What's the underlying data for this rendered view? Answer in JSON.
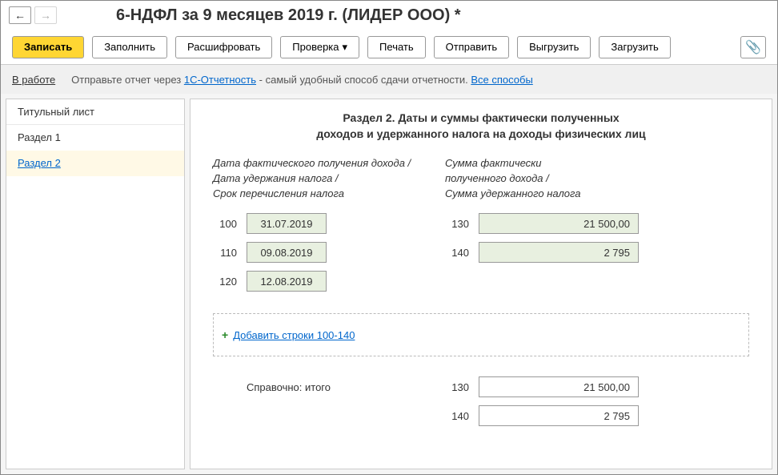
{
  "title": "6-НДФЛ за 9 месяцев 2019 г. (ЛИДЕР ООО) *",
  "toolbar": {
    "write": "Записать",
    "fill": "Заполнить",
    "decode": "Расшифровать",
    "check": "Проверка",
    "print": "Печать",
    "send": "Отправить",
    "export": "Выгрузить",
    "import": "Загрузить"
  },
  "status": {
    "label": "В работе",
    "text1": "Отправьте отчет через ",
    "link1": "1С-Отчетность",
    "text2": " - самый удобный способ сдачи отчетности. ",
    "link2": "Все способы"
  },
  "sidebar": {
    "items": [
      "Титульный лист",
      "Раздел 1",
      "Раздел 2"
    ],
    "active": 2
  },
  "section": {
    "title_line1": "Раздел 2.  Даты и суммы фактически полученных",
    "title_line2": "доходов и удержанного налога на доходы физических лиц",
    "left_head_l1": "Дата фактического получения дохода /",
    "left_head_l2": "Дата удержания налога /",
    "left_head_l3": "Срок перечисления налога",
    "right_head_l1": "Сумма фактически",
    "right_head_l2": "полученного дохода /",
    "right_head_l3": "Сумма удержанного налога",
    "rows_left": [
      {
        "num": "100",
        "val": "31.07.2019"
      },
      {
        "num": "110",
        "val": "09.08.2019"
      },
      {
        "num": "120",
        "val": "12.08.2019"
      }
    ],
    "rows_right": [
      {
        "num": "130",
        "val": "21 500,00"
      },
      {
        "num": "140",
        "val": "2 795"
      }
    ],
    "add_link": "Добавить строки 100-140",
    "total_label": "Справочно: итого",
    "totals": [
      {
        "num": "130",
        "val": "21 500,00"
      },
      {
        "num": "140",
        "val": "2 795"
      }
    ]
  }
}
